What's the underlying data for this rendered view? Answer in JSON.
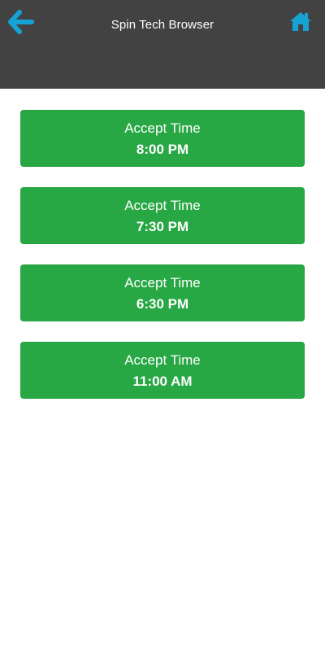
{
  "header": {
    "title": "Spin Tech Browser",
    "back_icon": "arrow-left-icon",
    "home_icon": "home-icon",
    "icon_color": "#17a2d6",
    "bg_color": "#424242"
  },
  "slots": [
    {
      "label": "Accept Time",
      "time": "8:00 PM"
    },
    {
      "label": "Accept Time",
      "time": "7:30 PM"
    },
    {
      "label": "Accept Time",
      "time": "6:30 PM"
    },
    {
      "label": "Accept Time",
      "time": "11:00 AM"
    }
  ],
  "colors": {
    "button": "#28a745",
    "button_text": "#ffffff"
  }
}
